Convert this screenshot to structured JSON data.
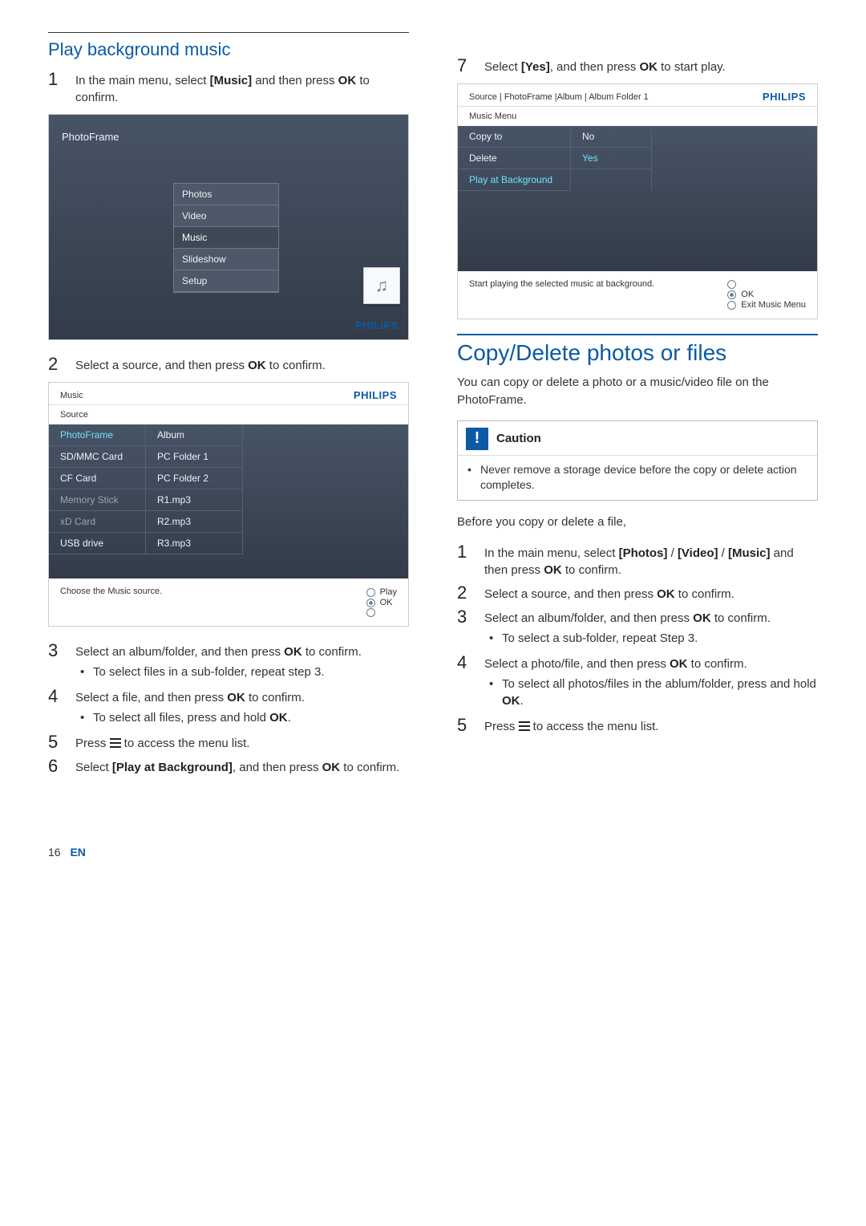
{
  "left": {
    "heading": "Play background music",
    "step1": "In the main menu, select [Music] and then press OK to confirm.",
    "shot1": {
      "pf": "PhotoFrame",
      "menu": [
        "Photos",
        "Video",
        "Music",
        "Slideshow",
        "Setup"
      ],
      "brand": "PHILIPS"
    },
    "step2": "Select a source, and then press OK to confirm.",
    "shot2": {
      "title": "Music",
      "brand": "PHILIPS",
      "subtitle": "Source",
      "col1": [
        "PhotoFrame",
        "SD/MMC Card",
        "CF Card",
        "Memory Stick",
        "xD Card",
        "USB drive"
      ],
      "col2": [
        "Album",
        "PC Folder 1",
        "PC Folder 2",
        "R1.mp3",
        "R2.mp3",
        "R3.mp3"
      ],
      "hint": "Choose the Music source.",
      "play": "Play",
      "ok": "OK"
    },
    "step3": "Select an album/folder, and then press OK to confirm.",
    "step3_sub": "To select files in a sub-folder, repeat step 3.",
    "step4": "Select a file, and then press OK to confirm.",
    "step4_sub": "To select all files, press and hold OK.",
    "step5_a": "Press ",
    "step5_b": " to access the menu list.",
    "step6": "Select [Play at Background], and then press OK to confirm."
  },
  "right": {
    "step7": "Select [Yes], and then press OK to start play.",
    "shot3": {
      "breadcrumb": "Source | FhotoFrame |Album | Album Folder 1",
      "brand": "PHILIPS",
      "subtitle": "Music Menu",
      "col1": [
        "Copy to",
        "Delete",
        "Play at Background"
      ],
      "col2": [
        "No",
        "Yes"
      ],
      "hint": "Start playing the selected music at background.",
      "ok": "OK",
      "exit": "Exit Music Menu"
    },
    "secthead": "Copy/Delete photos or files",
    "intro": "You can copy or delete a photo or a music/video file on the PhotoFrame.",
    "caution_label": "Caution",
    "caution_text": "Never remove a storage device before the copy or delete action completes.",
    "before": "Before you copy or delete a file,",
    "rstep1": "In the main menu, select [Photos] / [Video] / [Music] and then press OK to confirm.",
    "rstep2": "Select a source, and then press OK to confirm.",
    "rstep3": "Select an album/folder, and then press OK to confirm.",
    "rstep3_sub": "To select a sub-folder, repeat Step 3.",
    "rstep4": "Select a photo/file, and then press OK to confirm.",
    "rstep4_sub": "To select all photos/files in the ablum/folder, press and hold OK.",
    "rstep5_a": "Press ",
    "rstep5_b": " to access the menu list."
  },
  "footer": {
    "page": "16",
    "lang": "EN"
  }
}
